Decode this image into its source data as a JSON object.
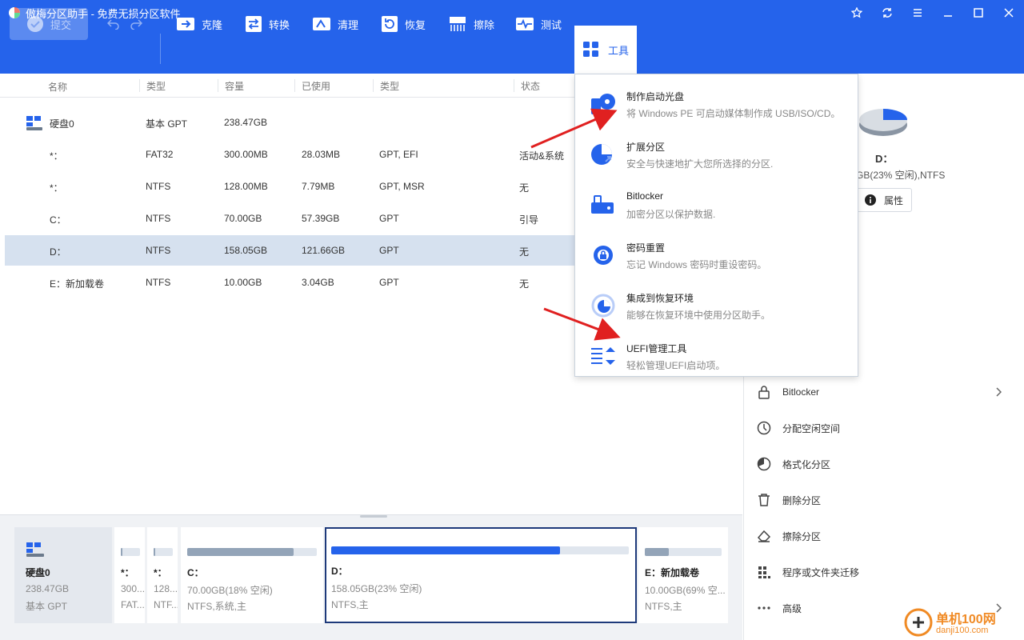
{
  "window": {
    "title": "傲梅分区助手 - 免费无损分区软件"
  },
  "toolbar": {
    "submit": "提交",
    "clone": "克隆",
    "convert": "转换",
    "clean": "清理",
    "recover": "恢复",
    "wipe": "擦除",
    "test": "测试",
    "tools": "工具"
  },
  "table": {
    "headers": [
      "名称",
      "类型",
      "容量",
      "已使用",
      "类型",
      "状态"
    ],
    "disk": {
      "name": "硬盘0",
      "type": "基本 GPT",
      "capacity": "238.47GB"
    },
    "rows": [
      {
        "name": "*：",
        "fs": "FAT32",
        "cap": "300.00MB",
        "used": "28.03MB",
        "ptype": "GPT, EFI",
        "status": "活动&系统"
      },
      {
        "name": "*：",
        "fs": "NTFS",
        "cap": "128.00MB",
        "used": "7.79MB",
        "ptype": "GPT, MSR",
        "status": "无"
      },
      {
        "name": "C：",
        "fs": "NTFS",
        "cap": "70.00GB",
        "used": "57.39GB",
        "ptype": "GPT",
        "status": "引导"
      },
      {
        "name": "D：",
        "fs": "NTFS",
        "cap": "158.05GB",
        "used": "121.66GB",
        "ptype": "GPT",
        "status": "无"
      },
      {
        "name": "E：新加载卷",
        "fs": "NTFS",
        "cap": "10.00GB",
        "used": "3.04GB",
        "ptype": "GPT",
        "status": "无"
      }
    ]
  },
  "menu": {
    "items": [
      {
        "title": "制作启动光盘",
        "desc": "将 Windows PE 可启动媒体制作成 USB/ISO/CD。"
      },
      {
        "title": "扩展分区",
        "desc": "安全与快速地扩大您所选择的分区."
      },
      {
        "title": "Bitlocker",
        "desc": "加密分区以保护数据."
      },
      {
        "title": "密码重置",
        "desc": "忘记 Windows 密码时重设密码。"
      },
      {
        "title": "集成到恢复环境",
        "desc": "能够在恢复环境中使用分区助手。"
      },
      {
        "title": "UEFI管理工具",
        "desc": "轻松管理UEFI启动项。"
      }
    ]
  },
  "side": {
    "drive": "D：",
    "info": "GB(23% 空闲),NTFS",
    "props": "属性",
    "items": [
      "Bitlocker",
      "分配空闲空间",
      "格式化分区",
      "删除分区",
      "擦除分区",
      "程序或文件夹迁移",
      "高级"
    ]
  },
  "bottom": {
    "disk": {
      "name": "硬盘0",
      "size": "238.47GB",
      "type": "基本 GPT"
    },
    "parts": [
      {
        "name": "*：",
        "l2": "300...",
        "l3": "FAT...",
        "fill": 0.1
      },
      {
        "name": "*：",
        "l2": "128...",
        "l3": "NTF...",
        "fill": 0.1
      },
      {
        "name": "C：",
        "l2": "70.00GB(18% 空闲)",
        "l3": "NTFS,系统,主",
        "fill": 0.82
      },
      {
        "name": "D：",
        "l2": "158.05GB(23% 空闲)",
        "l3": "NTFS,主",
        "fill": 0.77
      },
      {
        "name": "E：新加载卷",
        "l2": "10.00GB(69% 空...",
        "l3": "NTFS,主",
        "fill": 0.31
      }
    ]
  },
  "watermark": {
    "text1": "单机100网",
    "text2": "danji100.com"
  },
  "colors": {
    "primary": "#2563eb",
    "selected_row": "#d6e1ef",
    "fill_blue": "#2563eb",
    "arrow": "#e02020"
  }
}
